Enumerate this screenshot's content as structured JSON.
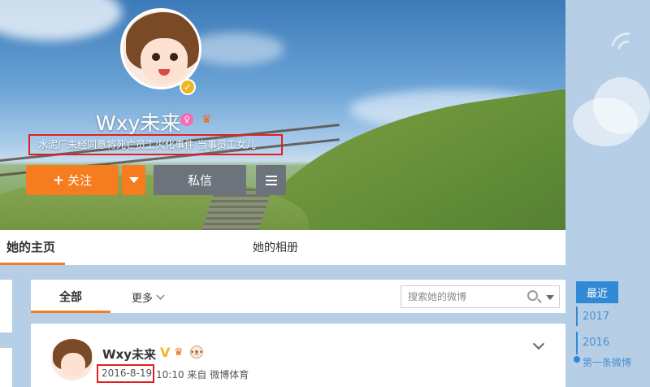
{
  "profile": {
    "name": "Wxy未来",
    "description": "水泥厂未经同意将死亡员工火化事件 当事员工女儿",
    "verified_badge": "V",
    "follow_label": "关注",
    "follow_plus": "+",
    "message_label": "私信"
  },
  "tabs": {
    "home": "她的主页",
    "album": "她的相册"
  },
  "feed_filter": {
    "all": "全部",
    "more": "更多",
    "search_placeholder": "搜索她的微博"
  },
  "post": {
    "author": "Wxy未来",
    "v_mark": "V",
    "date": "2016-8-19",
    "time_source": "10:10 来自 微博体育"
  },
  "timeline": {
    "recent": "最近",
    "years": [
      "2017",
      "2016"
    ],
    "first_post": "第一条微博"
  },
  "colors": {
    "orange": "#f57c1f",
    "gray_button": "#6d737c",
    "highlight_red": "#e21f1f",
    "timeline_blue": "#3189d4"
  },
  "icons": [
    "check-verified-icon",
    "female-icon",
    "member-crown-icon",
    "chevron-down-icon",
    "hamburger-menu-icon",
    "search-icon",
    "pet-icon"
  ]
}
